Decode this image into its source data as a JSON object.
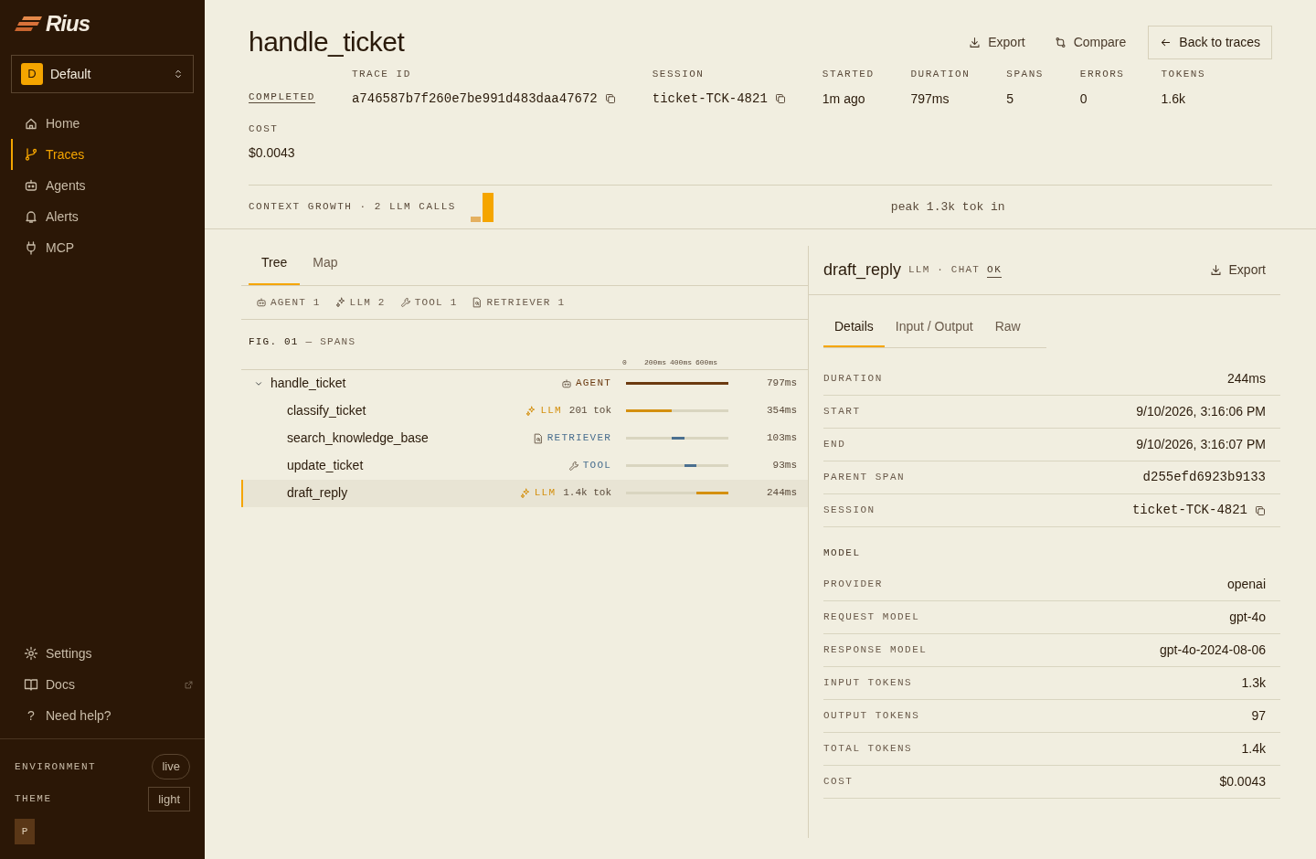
{
  "sidebar": {
    "logo": "Rius",
    "workspace": {
      "initial": "D",
      "name": "Default"
    },
    "nav": [
      {
        "label": "Home",
        "selected": false
      },
      {
        "label": "Traces",
        "selected": true
      },
      {
        "label": "Agents",
        "selected": false
      },
      {
        "label": "Alerts",
        "selected": false
      },
      {
        "label": "MCP",
        "selected": false
      }
    ],
    "footer_nav": [
      {
        "label": "Settings",
        "kind": "internal"
      },
      {
        "label": "Docs",
        "kind": "external"
      },
      {
        "label": "Need help?",
        "kind": "help",
        "glyph": "?"
      }
    ],
    "environment": {
      "label": "ENVIRONMENT",
      "value": "live"
    },
    "theme": {
      "label": "THEME",
      "value": "light"
    },
    "user": {
      "initial": "P"
    }
  },
  "header": {
    "title": "handle_ticket",
    "actions": [
      {
        "label": "Export",
        "kind": "link"
      },
      {
        "label": "Compare",
        "kind": "link"
      },
      {
        "label": "Back to traces",
        "kind": "outline"
      }
    ],
    "status": "COMPLETED",
    "fields": [
      {
        "label": "TRACE ID",
        "value": "a746587b7f260e7be991d483daa47672",
        "kind": "id"
      },
      {
        "label": "SESSION",
        "value": "ticket-TCK-4821",
        "kind": "id"
      },
      {
        "label": "STARTED",
        "value": "1m ago",
        "kind": "stat"
      },
      {
        "label": "DURATION",
        "value": "797ms",
        "kind": "stat"
      },
      {
        "label": "SPANS",
        "value": "5",
        "kind": "stat"
      },
      {
        "label": "ERRORS",
        "value": "0",
        "kind": "stat"
      },
      {
        "label": "TOKENS",
        "value": "1.6k",
        "kind": "stat"
      },
      {
        "label": "COST",
        "value": "$0.0043",
        "kind": "stat"
      }
    ]
  },
  "context_growth": {
    "label": "CONTEXT GROWTH · 2 LLM CALLS",
    "peak": "peak 1.3k tok in"
  },
  "trace_panel": {
    "tabs": [
      {
        "label": "Tree",
        "selected": true
      },
      {
        "label": "Map",
        "selected": false
      }
    ],
    "filters": [
      {
        "kind": "agent",
        "label": "AGENT",
        "count": "1"
      },
      {
        "kind": "llm",
        "label": "LLM",
        "count": "2"
      },
      {
        "kind": "tool",
        "label": "TOOL",
        "count": "1"
      },
      {
        "kind": "retriever",
        "label": "RETRIEVER",
        "count": "1"
      }
    ],
    "figure": {
      "number": "FIG. 01",
      "title": "— SPANS"
    },
    "axis_ticks": [
      "0",
      "200ms",
      "400ms",
      "600ms"
    ],
    "spans": [
      {
        "name": "handle_ticket",
        "kind": "agent",
        "type_label": "AGENT",
        "duration": "797ms",
        "expanded": true,
        "selected": false,
        "children": [
          {
            "name": "classify_ticket",
            "kind": "llm",
            "type_label": "LLM",
            "tokens": "201 tok",
            "duration": "354ms",
            "selected": false
          },
          {
            "name": "search_knowledge_base",
            "kind": "retriever",
            "type_label": "RETRIEVER",
            "duration": "103ms",
            "selected": false
          },
          {
            "name": "update_ticket",
            "kind": "tool",
            "type_label": "TOOL",
            "duration": "93ms",
            "selected": false
          },
          {
            "name": "draft_reply",
            "kind": "llm",
            "type_label": "LLM",
            "tokens": "1.4k tok",
            "duration": "244ms",
            "selected": true
          }
        ]
      }
    ]
  },
  "detail_panel": {
    "title": "draft_reply",
    "type": "LLM · CHAT",
    "status": "OK",
    "export": "Export",
    "tabs": [
      {
        "label": "Details",
        "selected": true
      },
      {
        "label": "Input / Output",
        "selected": false
      },
      {
        "label": "Raw",
        "selected": false
      }
    ],
    "rows": [
      {
        "kind": "row",
        "label": "DURATION",
        "value": "244ms"
      },
      {
        "kind": "row",
        "label": "START",
        "value": "9/10/2026, 3:16:06 PM"
      },
      {
        "kind": "row",
        "label": "END",
        "value": "9/10/2026, 3:16:07 PM"
      },
      {
        "kind": "mono",
        "label": "PARENT SPAN",
        "value": "d255efd6923b9133"
      },
      {
        "kind": "copy",
        "label": "SESSION",
        "value": "ticket-TCK-4821"
      },
      {
        "kind": "section",
        "label": "MODEL"
      },
      {
        "kind": "row",
        "label": "PROVIDER",
        "value": "openai"
      },
      {
        "kind": "row",
        "label": "REQUEST MODEL",
        "value": "gpt-4o"
      },
      {
        "kind": "row",
        "label": "RESPONSE MODEL",
        "value": "gpt-4o-2024-08-06"
      },
      {
        "kind": "row",
        "label": "INPUT TOKENS",
        "value": "1.3k"
      },
      {
        "kind": "row",
        "label": "OUTPUT TOKENS",
        "value": "97"
      },
      {
        "kind": "row",
        "label": "TOTAL TOKENS",
        "value": "1.4k"
      },
      {
        "kind": "row",
        "label": "COST",
        "value": "$0.0043"
      }
    ]
  }
}
